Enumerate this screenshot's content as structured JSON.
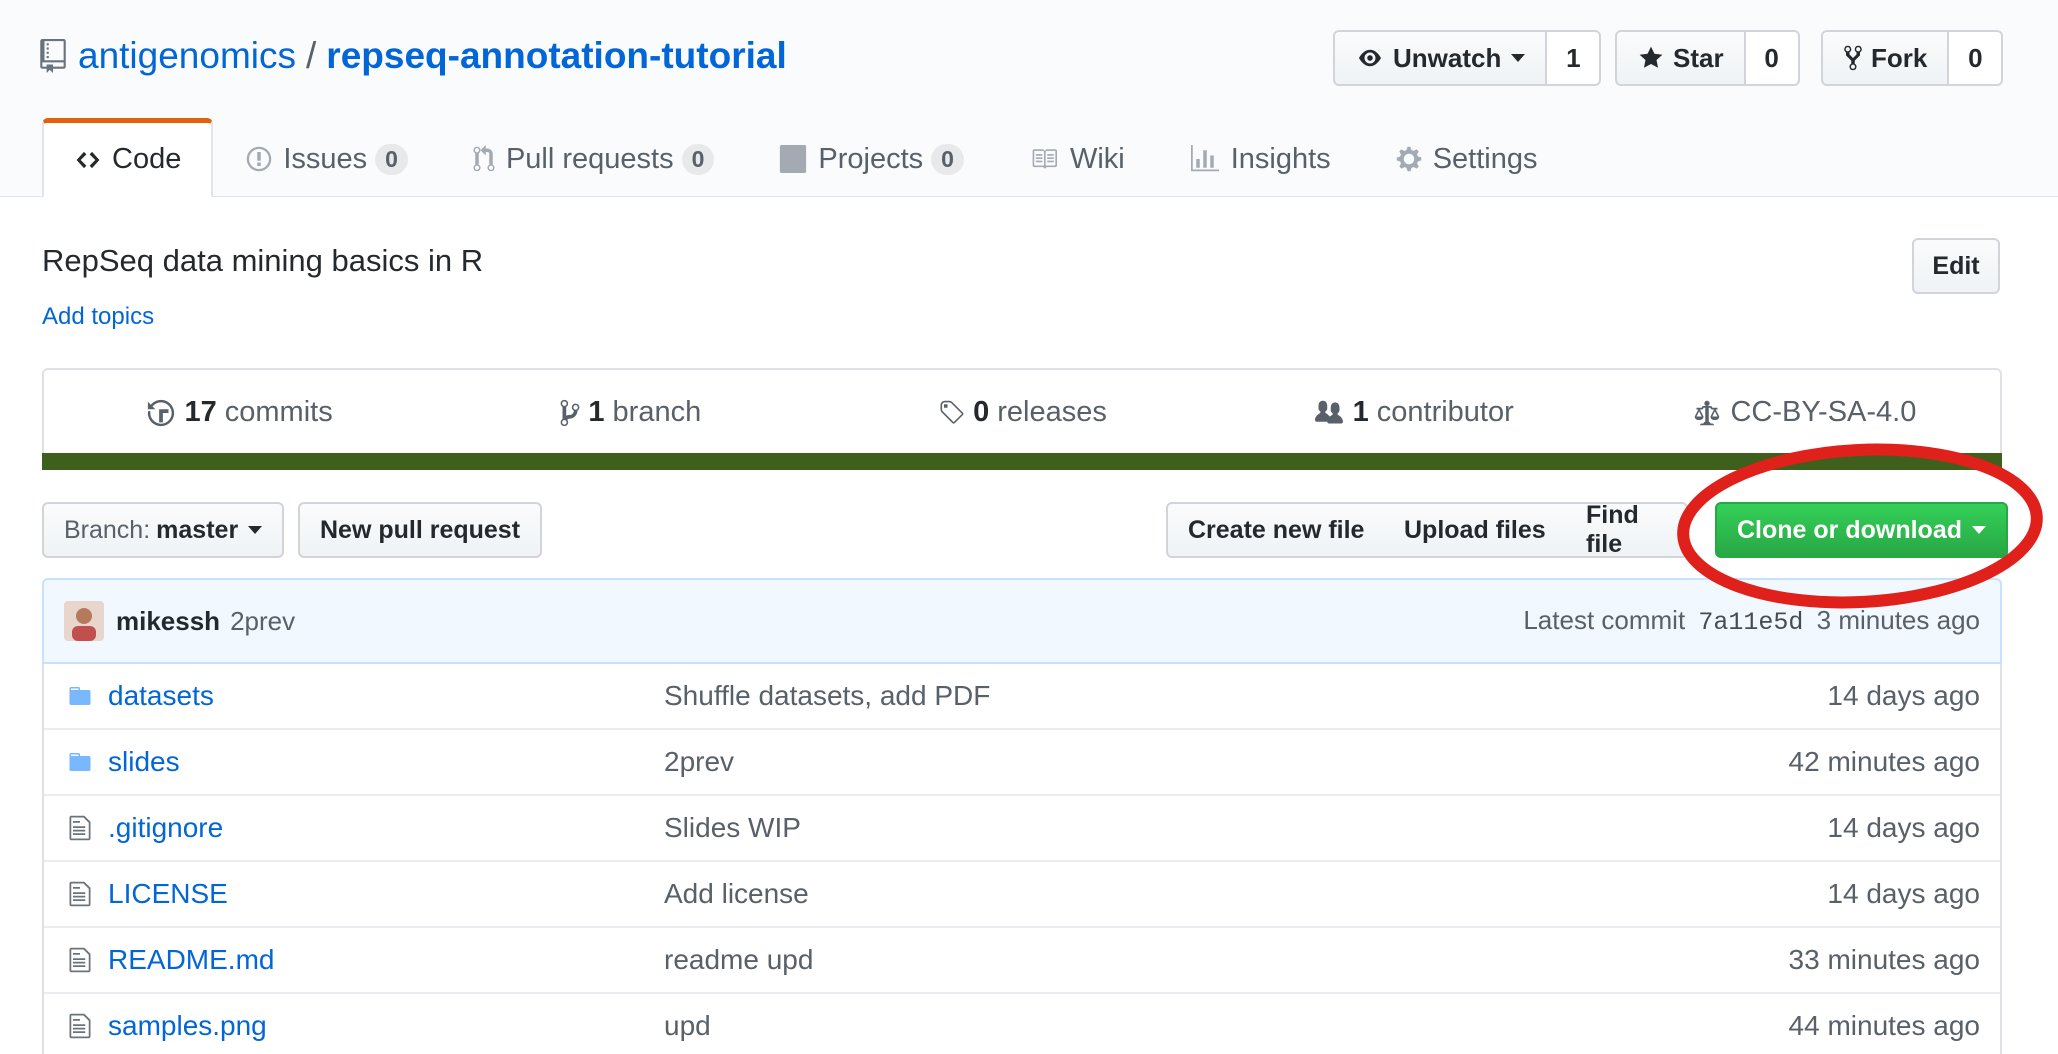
{
  "repo": {
    "owner": "antigenomics",
    "separator": "/",
    "name": "repseq-annotation-tutorial"
  },
  "actions": {
    "watch_label": "Unwatch",
    "watch_count": "1",
    "star_label": "Star",
    "star_count": "0",
    "fork_label": "Fork",
    "fork_count": "0"
  },
  "tabs": [
    {
      "label": "Code",
      "icon": "code-icon",
      "selected": true
    },
    {
      "label": "Issues",
      "count": "0",
      "icon": "issue-icon"
    },
    {
      "label": "Pull requests",
      "count": "0",
      "icon": "pull-request-icon"
    },
    {
      "label": "Projects",
      "count": "0",
      "icon": "project-icon"
    },
    {
      "label": "Wiki",
      "icon": "book-icon"
    },
    {
      "label": "Insights",
      "icon": "graph-icon"
    },
    {
      "label": "Settings",
      "icon": "gear-icon"
    }
  ],
  "description": {
    "text": "RepSeq data mining basics in R",
    "add_topics": "Add topics",
    "edit_label": "Edit"
  },
  "summary": {
    "commits_num": "17",
    "commits_label": "commits",
    "branch_num": "1",
    "branch_label": "branch",
    "releases_num": "0",
    "releases_label": "releases",
    "contributor_num": "1",
    "contributor_label": "contributor",
    "license": "CC-BY-SA-4.0",
    "language_color": "#3f5f1c"
  },
  "file_nav": {
    "branch_prefix": "Branch:",
    "branch_name": "master",
    "new_pr": "New pull request",
    "create_file": "Create new file",
    "upload_files": "Upload files",
    "find_file": "Find file",
    "clone": "Clone or download"
  },
  "commit": {
    "author": "mikessh",
    "message": "2prev",
    "latest_label": "Latest commit",
    "sha": "7a11e5d",
    "age": "3 minutes ago"
  },
  "files": [
    {
      "type": "folder",
      "icon": "folder-icon",
      "name": "datasets",
      "message": "Shuffle datasets, add PDF",
      "age": "14 days ago"
    },
    {
      "type": "folder",
      "icon": "folder-icon",
      "name": "slides",
      "message": "2prev",
      "age": "42 minutes ago"
    },
    {
      "type": "file",
      "icon": "file-icon",
      "name": ".gitignore",
      "message": "Slides WIP",
      "age": "14 days ago"
    },
    {
      "type": "file",
      "icon": "file-icon",
      "name": "LICENSE",
      "message": "Add license",
      "age": "14 days ago"
    },
    {
      "type": "file",
      "icon": "file-icon",
      "name": "README.md",
      "message": "readme upd",
      "age": "33 minutes ago"
    },
    {
      "type": "file",
      "icon": "file-icon",
      "name": "samples.png",
      "message": "upd",
      "age": "44 minutes ago"
    }
  ],
  "colors": {
    "link": "#0366d6",
    "primary_button": "#28a745",
    "selected_tab_accent": "#e36209",
    "highlight_annotation": "#e0201b"
  }
}
